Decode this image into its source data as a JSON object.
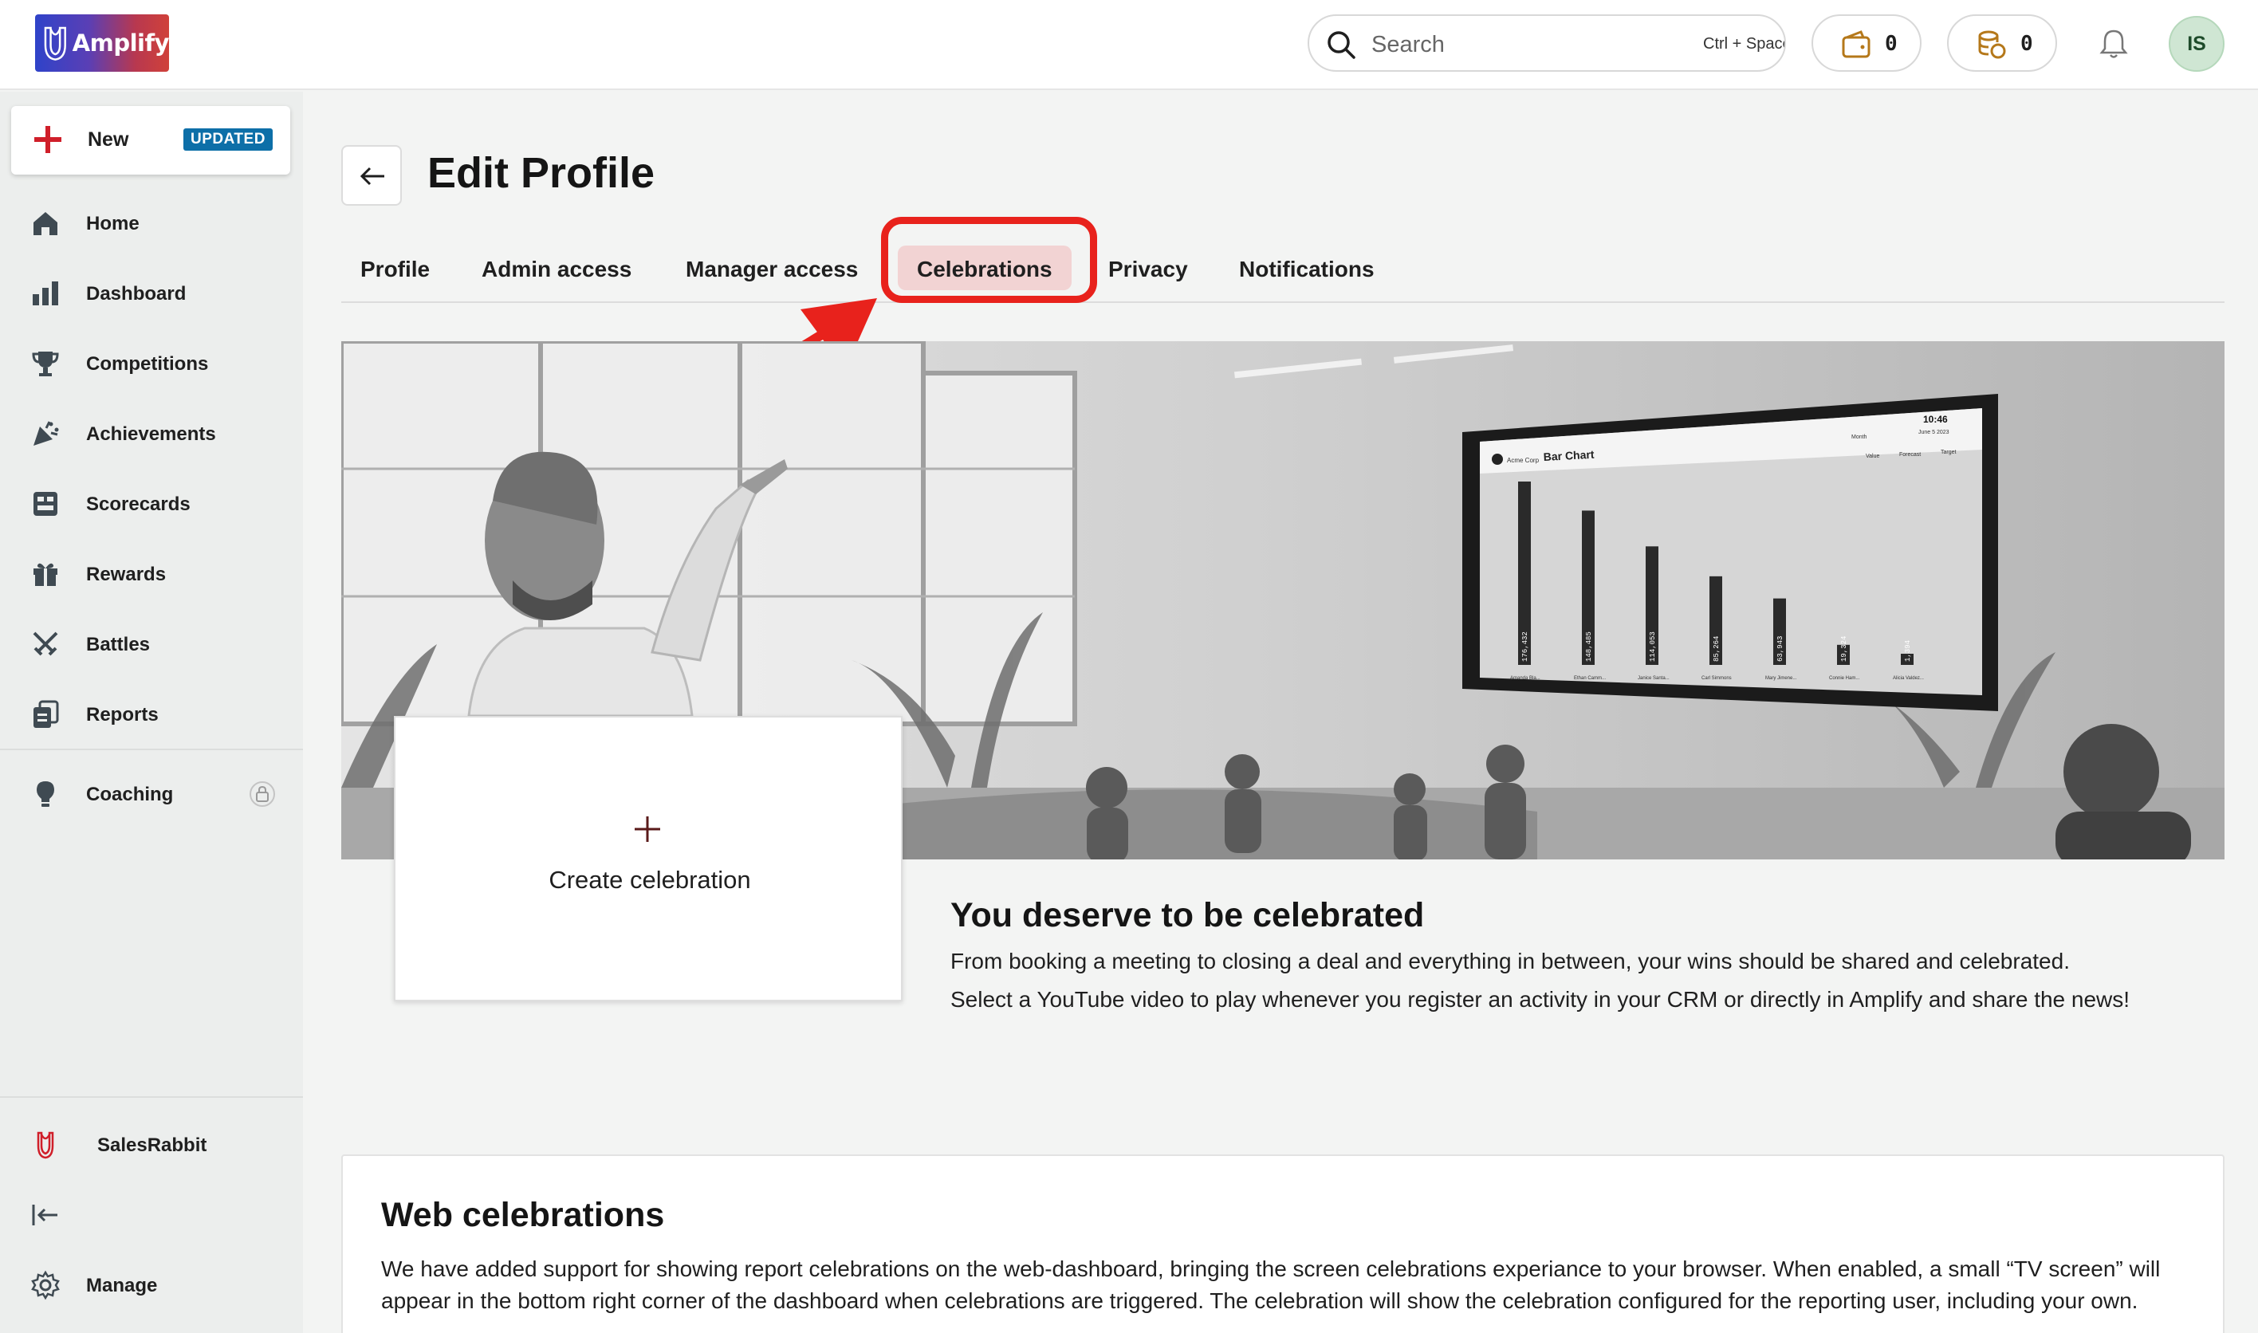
{
  "app": {
    "name": "Amplify"
  },
  "topbar": {
    "search_placeholder": "Search",
    "search_shortcut": "Ctrl + Space",
    "wallet_count": "0",
    "coins_count": "0",
    "avatar_initials": "IS"
  },
  "sidebar": {
    "new_label": "New",
    "new_badge": "UPDATED",
    "items": [
      {
        "label": "Home",
        "icon": "home-icon"
      },
      {
        "label": "Dashboard",
        "icon": "bar-chart-icon"
      },
      {
        "label": "Competitions",
        "icon": "trophy-icon"
      },
      {
        "label": "Achievements",
        "icon": "party-popper-icon"
      },
      {
        "label": "Scorecards",
        "icon": "scorecard-icon"
      },
      {
        "label": "Rewards",
        "icon": "gift-icon"
      },
      {
        "label": "Battles",
        "icon": "swords-icon"
      },
      {
        "label": "Reports",
        "icon": "reports-icon"
      }
    ],
    "coaching_label": "Coaching",
    "org_label": "SalesRabbit",
    "manage_label": "Manage"
  },
  "page": {
    "title": "Edit Profile",
    "tabs": [
      {
        "label": "Profile",
        "active": false
      },
      {
        "label": "Admin access",
        "active": false
      },
      {
        "label": "Manager access",
        "active": false
      },
      {
        "label": "Celebrations",
        "active": true
      },
      {
        "label": "Privacy",
        "active": false
      },
      {
        "label": "Notifications",
        "active": false
      }
    ]
  },
  "hero": {
    "tv_company": "Acme Corp",
    "tv_title": "Bar Chart",
    "tv_time": "10:46",
    "tv_date": "June 5 2023",
    "tv_period": "Month",
    "tv_legend": [
      "Value",
      "Forecast",
      "Target"
    ],
    "tv_values": [
      "176,432",
      "148,485",
      "114,053",
      "85,264",
      "63,943",
      "19,324",
      "1,394"
    ],
    "tv_names": [
      "Amanda Bla...",
      "Ethan Camm...",
      "Janice Santa...",
      "Carl Simmons",
      "Mary Jimene...",
      "Connie Ham...",
      "Alicia Valdez..."
    ]
  },
  "celebrations": {
    "create_label": "Create celebration",
    "heading": "You deserve to be celebrated",
    "line1": "From booking a meeting to closing a deal and everything in between, your wins should be shared and celebrated.",
    "line2": "Select a YouTube video to play whenever you register an activity in your CRM or directly in Amplify and share the news!"
  },
  "web_celebrations": {
    "heading": "Web celebrations",
    "body": "We have added support for showing report celebrations on the web-dashboard, bringing the screen celebrations experiance to your browser. When enabled, a small “TV screen” will appear in the bottom right corner of the dashboard when celebrations are triggered. The celebration will show the celebration configured for the reporting user, including your own."
  },
  "colors": {
    "accent_red": "#e8221c",
    "active_tab_bg": "#f2d3d3",
    "badge_blue": "#0d6fa8",
    "avatar_green": "#cfe6d3"
  }
}
